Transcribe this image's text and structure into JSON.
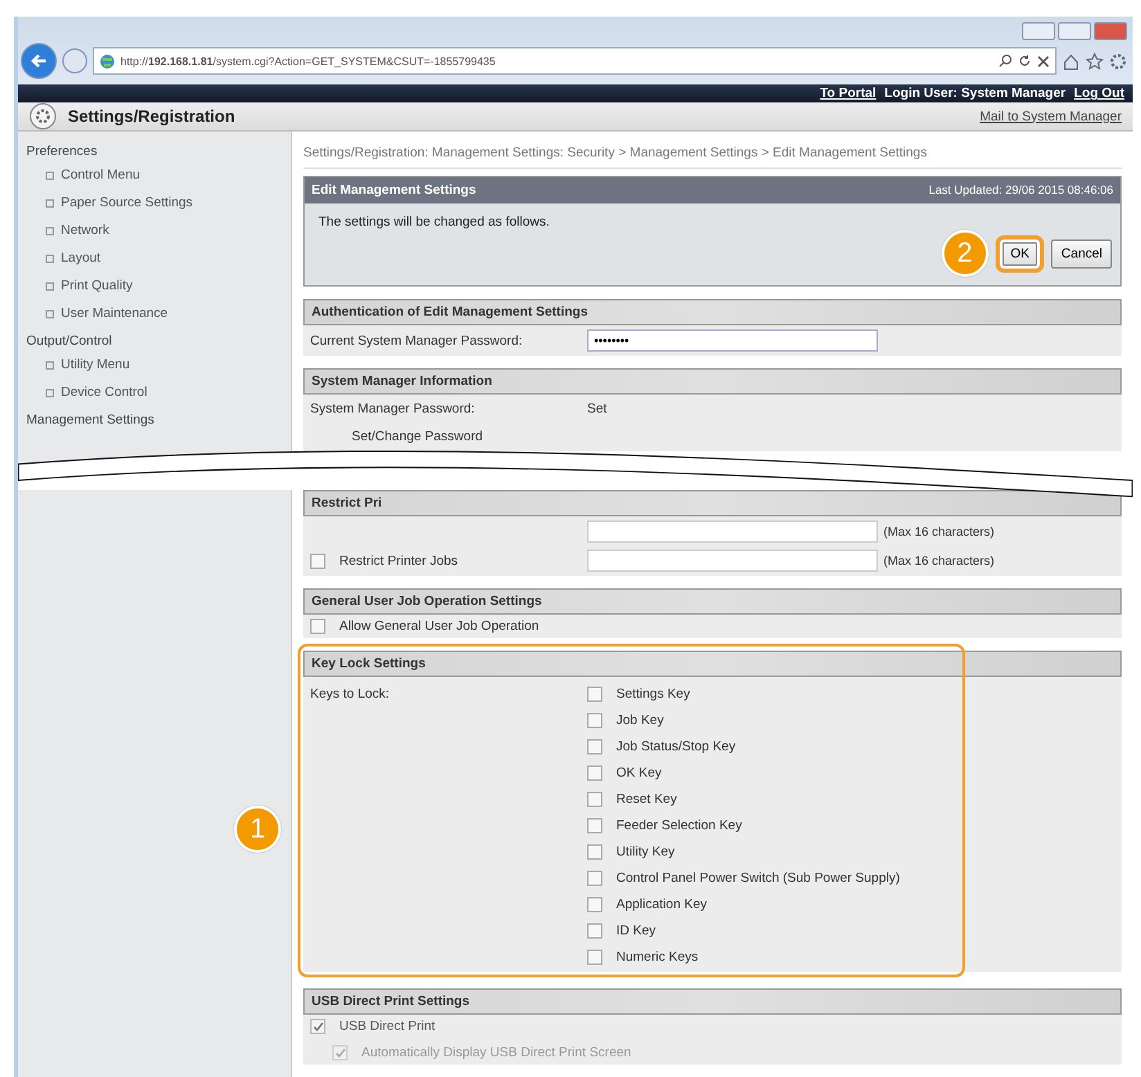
{
  "browser": {
    "url": "http://**192.168.1.81**/system.cgi?Action=GET_SYSTEM&CSUT=-1855799435"
  },
  "topbar": {
    "items": [
      {
        "kind": "link",
        "text": "To Portal"
      },
      {
        "kind": "text",
        "text": "Login User: System Manager"
      },
      {
        "kind": "link",
        "text": "Log Out"
      }
    ]
  },
  "header": {
    "title": "Settings/Registration",
    "link": "Mail to System Manager"
  },
  "sidebar": {
    "groups": [
      {
        "label": "Preferences",
        "items": [
          "Control Menu",
          "Paper Source Settings",
          "Network",
          "Layout",
          "Print Quality",
          "User Maintenance"
        ]
      },
      {
        "label": "Output/Control",
        "items": [
          "Utility Menu",
          "Device Control"
        ]
      },
      {
        "label": "Management Settings"
      }
    ]
  },
  "breadcrumb": "Settings/Registration: Management Settings: Security > Management Settings > Edit Management Settings",
  "edit_panel": {
    "title": "Edit Management Settings",
    "last_updated": "Last Updated: 29/06 2015 08:46:06",
    "message": "The settings will be changed as follows.",
    "callout": "2",
    "buttons": [
      {
        "label": "OK",
        "highlighted": true
      },
      {
        "label": "Cancel",
        "highlighted": false
      }
    ]
  },
  "sections_above": [
    {
      "title": "Authentication of Edit Management Settings",
      "rows": [
        {
          "kind": "password",
          "label": "Current System Manager Password:",
          "value": "••••••••"
        }
      ]
    },
    {
      "title": "System Manager Information",
      "rows": [
        {
          "kind": "value",
          "label": "System Manager Password:",
          "value": "Set"
        },
        {
          "kind": "text",
          "label": "Set/Change Password"
        }
      ]
    }
  ],
  "sections_below": [
    {
      "title": "Restrict Pri",
      "rows": [
        {
          "kind": "field",
          "note": "(Max 16 characters)"
        },
        {
          "kind": "checkbox_field",
          "label": "Restrict Printer Jobs",
          "checked": false,
          "note": "(Max 16 characters)"
        }
      ]
    },
    {
      "title": "General User Job Operation Settings",
      "rows": [
        {
          "kind": "checkbox",
          "label": "Allow General User Job Operation",
          "checked": false
        }
      ]
    }
  ],
  "key_lock": {
    "title": "Key Lock Settings",
    "label": "Keys to Lock:",
    "callout": "1",
    "keys": [
      {
        "label": "Settings Key",
        "checked": false
      },
      {
        "label": "Job Key",
        "checked": false
      },
      {
        "label": "Job Status/Stop Key",
        "checked": false
      },
      {
        "label": "OK Key",
        "checked": false
      },
      {
        "label": "Reset Key",
        "checked": false
      },
      {
        "label": "Feeder Selection Key",
        "checked": false
      },
      {
        "label": "Utility Key",
        "checked": false
      },
      {
        "label": "Control Panel Power Switch (Sub Power Supply)",
        "checked": false
      },
      {
        "label": "Application Key",
        "checked": false
      },
      {
        "label": "ID Key",
        "checked": false
      },
      {
        "label": "Numeric Keys",
        "checked": false
      }
    ]
  },
  "usb": {
    "title": "USB Direct Print Settings",
    "options": [
      {
        "label": "USB Direct Print",
        "checked": true,
        "kind": "main"
      },
      {
        "label": "Automatically Display USB Direct Print Screen",
        "checked": true,
        "kind": "sub"
      }
    ]
  }
}
